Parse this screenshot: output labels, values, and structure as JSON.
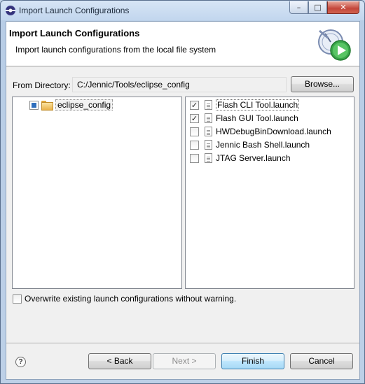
{
  "window": {
    "title": "Import Launch Configurations",
    "minimize_glyph": "–",
    "maximize_glyph": "□",
    "close_glyph": "✕"
  },
  "header": {
    "title": "Import Launch Configurations",
    "description": "Import launch configurations from the local file system"
  },
  "directory": {
    "label": "From Directory:",
    "value": "C:/Jennic/Tools/eclipse_config",
    "browse_label": "Browse..."
  },
  "tree": {
    "items": [
      {
        "label": "eclipse_config",
        "state": "partial"
      }
    ]
  },
  "files": [
    {
      "label": "Flash CLI Tool.launch",
      "checked": true,
      "check": "✓"
    },
    {
      "label": "Flash GUI Tool.launch",
      "checked": true,
      "check": "✓"
    },
    {
      "label": "HWDebugBinDownload.launch",
      "checked": false,
      "check": ""
    },
    {
      "label": "Jennic Bash Shell.launch",
      "checked": false,
      "check": ""
    },
    {
      "label": "JTAG Server.launch",
      "checked": false,
      "check": ""
    }
  ],
  "overwrite": {
    "label": "Overwrite existing launch configurations without warning.",
    "checked": false
  },
  "buttons": {
    "help_glyph": "?",
    "back": "< Back",
    "next": "Next >",
    "finish": "Finish",
    "cancel": "Cancel"
  }
}
